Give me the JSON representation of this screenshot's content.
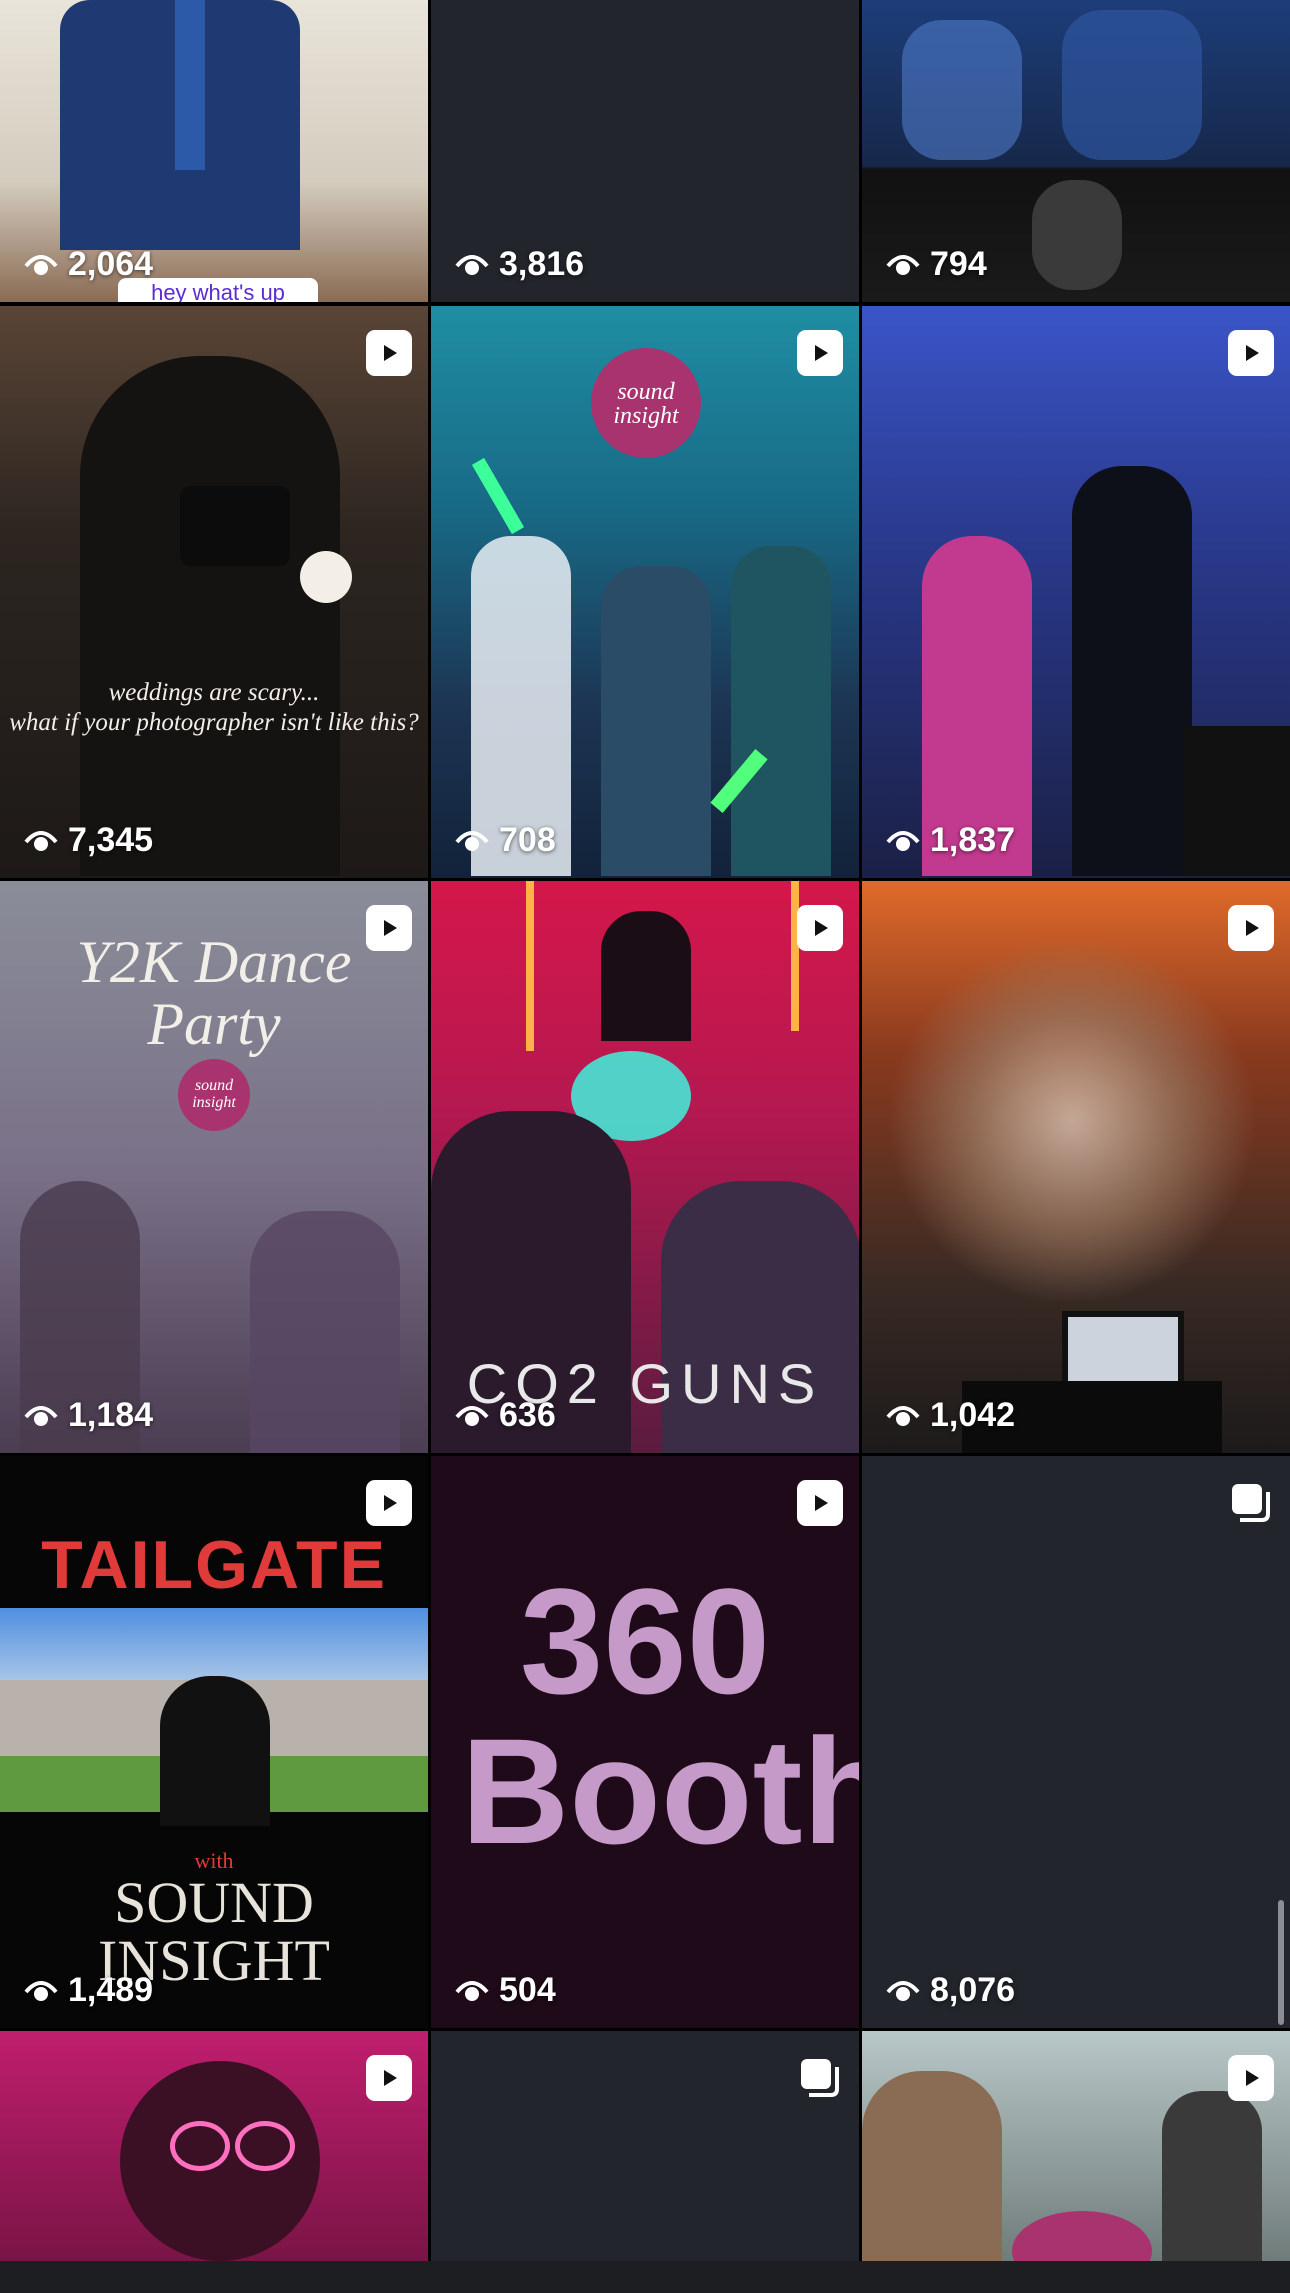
{
  "grid": {
    "tiles": [
      {
        "views": "2,064",
        "type": "none",
        "caption": "hey what's up"
      },
      {
        "views": "3,816",
        "type": "none",
        "caption": ""
      },
      {
        "views": "794",
        "type": "none",
        "caption": ""
      },
      {
        "views": "7,345",
        "type": "video",
        "caption": "weddings are scary...\nwhat if your photographer isn't like this?"
      },
      {
        "views": "708",
        "type": "video",
        "caption": "sound insight"
      },
      {
        "views": "1,837",
        "type": "video",
        "caption": ""
      },
      {
        "views": "1,184",
        "type": "video",
        "caption": "Y2K Dance Party"
      },
      {
        "views": "636",
        "type": "video",
        "caption": "CO2 GUNS"
      },
      {
        "views": "1,042",
        "type": "video",
        "caption": ""
      },
      {
        "views": "1,489",
        "type": "video",
        "caption": "TAILGATE"
      },
      {
        "views": "504",
        "type": "video",
        "caption": "360 Booth"
      },
      {
        "views": "8,076",
        "type": "carousel",
        "caption": ""
      },
      {
        "views": "",
        "type": "video",
        "caption": ""
      },
      {
        "views": "",
        "type": "carousel",
        "caption": ""
      },
      {
        "views": "",
        "type": "video",
        "caption": ""
      }
    ],
    "extra_text": {
      "tailgate_with": "with",
      "tailgate_brand": "SOUND INSIGHT",
      "y2k_logo": "sound insight"
    }
  },
  "colors": {
    "background": "#000000",
    "empty_tile": "#22252c",
    "overlay_text": "#ffffff"
  }
}
